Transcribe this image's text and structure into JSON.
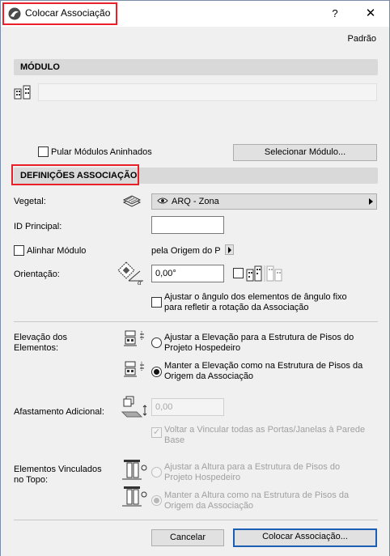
{
  "window": {
    "title": "Colocar Associação",
    "help": "?",
    "close": "✕"
  },
  "header": {
    "link": "Padrão"
  },
  "modulo": {
    "section_title": "MÓDULO",
    "skip_nested_label": "Pular Módulos Aninhados",
    "select_button": "Selecionar Módulo..."
  },
  "definicoes": {
    "section_title": "DEFINIÇÕES ASSOCIAÇÃO",
    "vegetal_label": "Vegetal:",
    "vegetal_value": "ARQ - Zona",
    "id_label": "ID Principal:",
    "id_value": "",
    "align_label": "Alinhar Módulo",
    "align_value": "pela Origem do P",
    "orientation_label": "Orientação:",
    "orientation_value": "0,00°",
    "angle_option_line1": "Ajustar o ângulo dos elementos de ângulo fixo",
    "angle_option_line2": "para refletir a rotação da Associação"
  },
  "elevacao": {
    "label_line1": "Elevação dos",
    "label_line2": "Elementos:",
    "option1_line1": "Ajustar a Elevação para a Estrutura de Pisos do",
    "option1_line2": "Projeto Hospedeiro",
    "option2_line1": "Manter a Elevação como na Estrutura de Pisos da",
    "option2_line2": "Origem da Associação",
    "selected": 2
  },
  "afastamento": {
    "label": "Afastamento Adicional:",
    "value": "0,00",
    "revincular_line1": "Voltar a Vincular todas as Portas/Janelas à Parede",
    "revincular_line2": "Base"
  },
  "vinculados": {
    "label_line1": "Elementos Vinculados",
    "label_line2": "no Topo:",
    "option1_line1": "Ajustar a Altura para a Estrutura de Pisos do",
    "option1_line2": "Projeto Hospedeiro",
    "option2_line1": "Manter a Altura como na Estrutura de Pisos da",
    "option2_line2": "Origem da Associação",
    "selected": 2
  },
  "footer": {
    "cancel": "Cancelar",
    "place": "Colocar Associação..."
  },
  "colors": {
    "highlight_border": "#e8202a",
    "primary_border": "#1a5fb4",
    "section_bar": "#d9d9d9"
  }
}
